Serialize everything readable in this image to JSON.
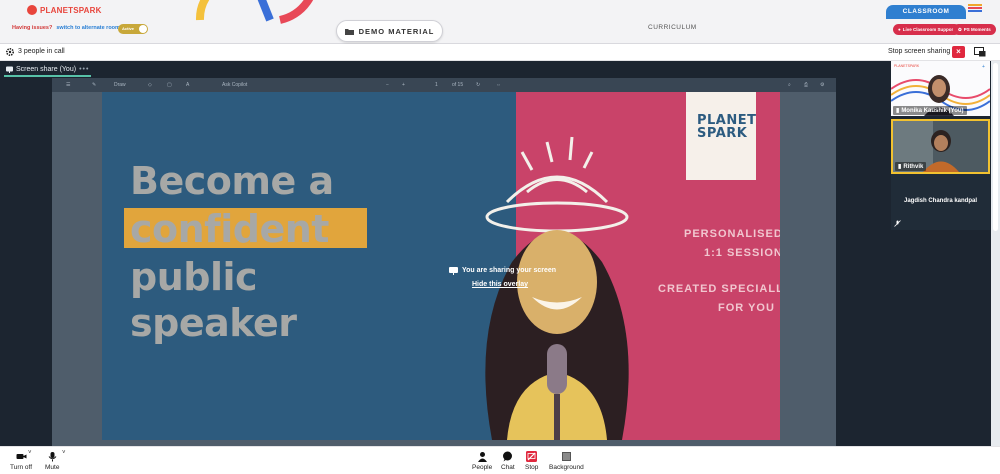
{
  "brand": {
    "logo_text": "PLANETSPARK"
  },
  "header": {
    "issue_question": "Having issues?",
    "issue_alternate": "switch to alternate room",
    "toggle_label": "Active",
    "demo_button": "DEMO MATERIAL",
    "curriculum_label": "CURRICULUM",
    "classroom_tab": "CLASSROOM",
    "live_support_button": "Live Classroom Support",
    "ps_moments_button": "PS Moments"
  },
  "call": {
    "people_count": "3 people in call",
    "stop_share": "Stop screen sharing"
  },
  "stage": {
    "tab_label": "Screen share (You)",
    "tab_more": "•••",
    "pdf_toolbar": {
      "draw": "Draw",
      "ask": "Ask Copilot",
      "page": "1",
      "of": "of 15"
    },
    "overlay_text": "You are sharing your screen",
    "overlay_hide": "Hide this overlay"
  },
  "slide": {
    "headline_lines": [
      "Become a",
      "confident",
      "public",
      "speaker"
    ],
    "brand_badge_lines": [
      "PLANET",
      "SPARK"
    ],
    "right_lines": [
      "PERSONALISED",
      "1:1 SESSION",
      "CREATED SPECIALLY",
      "FOR YOU"
    ],
    "colors": {
      "left_bg": "#2d5b7e",
      "right_bg": "#c94369",
      "highlight": "#e1a53c"
    }
  },
  "participants": [
    {
      "name": "Monika Kaushik (You)"
    },
    {
      "name": "Rithvik"
    },
    {
      "name": "Jagdish Chandra kandpal"
    }
  ],
  "controls": {
    "camera": "Turn off",
    "mic": "Mute",
    "people": "People",
    "chat": "Chat",
    "stop": "Stop",
    "background": "Background"
  },
  "icons": [
    "gear-icon",
    "folder-icon",
    "close-icon",
    "picture-in-picture-icon",
    "present-icon",
    "camera-icon",
    "microphone-icon",
    "people-icon",
    "chat-icon",
    "stop-share-icon",
    "background-icon",
    "muted-mic-icon"
  ]
}
